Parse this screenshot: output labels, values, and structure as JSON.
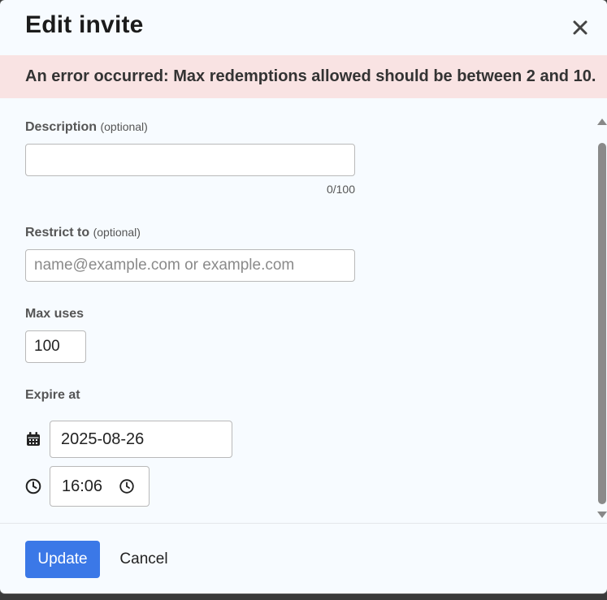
{
  "modal": {
    "title": "Edit invite",
    "close_icon": "close-icon"
  },
  "alert": {
    "message": "An error occurred: Max redemptions allowed should be between 2 and 10."
  },
  "form": {
    "description": {
      "label": "Description",
      "optional": "(optional)",
      "value": "",
      "counter": "0/100"
    },
    "restrict_to": {
      "label": "Restrict to",
      "optional": "(optional)",
      "value": "",
      "placeholder": "name@example.com or example.com"
    },
    "max_uses": {
      "label": "Max uses",
      "value": "100"
    },
    "expire_at": {
      "label": "Expire at",
      "date_icon": "calendar-icon",
      "date_value": "2025-08-26",
      "time_icon": "clock-icon",
      "time_value": "16:06"
    }
  },
  "footer": {
    "update_label": "Update",
    "cancel_label": "Cancel"
  },
  "colors": {
    "primary": "#3b78e7",
    "alert_bg": "#f9e3e3",
    "modal_bg": "#f7fbff"
  }
}
